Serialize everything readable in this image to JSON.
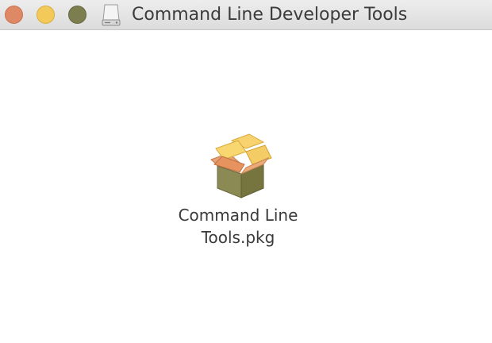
{
  "window": {
    "title": "Command Line Developer Tools",
    "title_icon": "disk-image-icon",
    "traffic_lights": {
      "close_color": "#de8865",
      "minimize_color": "#f3c95a",
      "zoom_color": "#7d7e50"
    }
  },
  "content": {
    "files": [
      {
        "icon": "package-icon",
        "label_line1": "Command Line",
        "label_line2": "Tools.pkg"
      }
    ]
  }
}
